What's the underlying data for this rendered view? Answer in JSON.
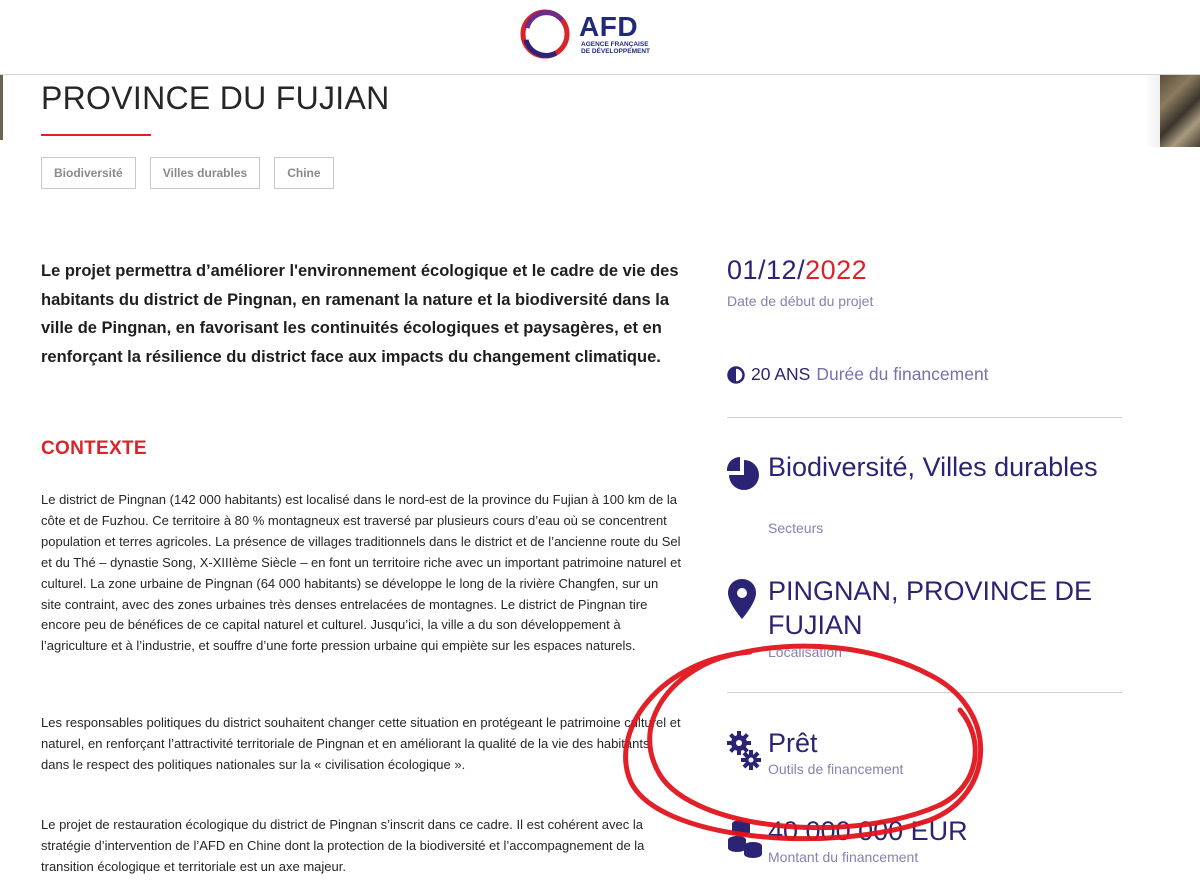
{
  "header": {
    "logo_name": "AFD",
    "logo_sub": "AGENCE FRANÇAISE DE DÉVELOPPEMENT"
  },
  "page": {
    "title": "PROVINCE DU FUJIAN",
    "tags": [
      "Biodiversité",
      "Villes durables",
      "Chine"
    ]
  },
  "intro": "Le projet permettra d’améliorer l'environnement écologique et le cadre de vie des habitants du district de Pingnan, en ramenant la nature et la biodiversité dans la ville de Pingnan, en favorisant les continuités écologiques et paysagères, et en renforçant la résilience du district face aux impacts du changement climatique.",
  "context": {
    "heading": "CONTEXTE",
    "paragraphs": [
      "Le district de Pingnan (142 000 habitants) est localisé dans le nord-est de la province du Fujian à 100 km de la côte et de Fuzhou. Ce territoire à 80 % montagneux est traversé par plusieurs cours d’eau où se concentrent population et terres agricoles. La présence de villages traditionnels dans le district et de l’ancienne route du Sel et du Thé – dynastie Song, X-XIIIème Siècle – en font un territoire riche avec un important patrimoine naturel et culturel. La zone urbaine de Pingnan (64 000 habitants) se développe le long de la rivière Changfen, sur un site contraint, avec des zones urbaines très denses entrelacées de montagnes. Le district de Pingnan tire encore peu de bénéfices de ce capital naturel et culturel. Jusqu’ici, la ville a du son développement à l’agriculture et à l’industrie, et souffre d’une forte pression urbaine qui empiète sur les espaces naturels.",
      "Les responsables politiques du district souhaitent changer cette situation en protégeant le patrimoine culturel et naturel, en renforçant l’attractivité territoriale de Pingnan et en améliorant la qualité de la vie des habitants dans le respect des politiques nationales sur la « civilisation écologique ».",
      "Le projet de restauration écologique du district de Pingnan s’inscrit dans ce cadre. Il est cohérent avec la stratégie d’intervention de l’AFD en Chine dont la protection de la biodiversité et l’accompagnement de la transition écologique et territoriale est un axe majeur."
    ]
  },
  "sidebar": {
    "date_prefix": "01/12/",
    "date_year": "2022",
    "date_label": "Date de début du projet",
    "duration_value": "20 ANS",
    "duration_label": "Durée du financement",
    "sectors_value": "Biodiversité, Villes durables",
    "sectors_label": "Secteurs",
    "location_value": "PINGNAN, PROVINCE DE FUJIAN",
    "location_label": "Localisation",
    "tool_value": "Prêt",
    "tool_label": "Outils de financement",
    "amount_value": "40 000 000 EUR",
    "amount_label": "Montant du financement"
  },
  "colors": {
    "brand_blue": "#2b2373",
    "accent_red": "#d8242a",
    "label_purple": "#8a7fb0",
    "annotation_red": "#e0141b"
  },
  "icons": [
    "afd-logo-ring",
    "clock-icon",
    "pie-chart-icon",
    "location-pin-icon",
    "gears-icon",
    "coins-icon"
  ]
}
